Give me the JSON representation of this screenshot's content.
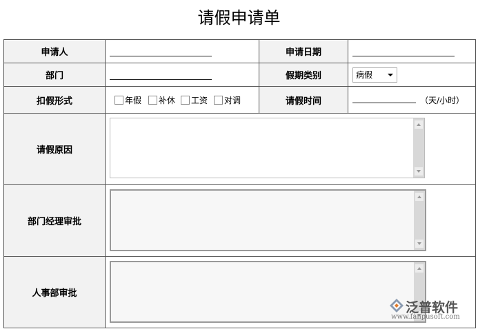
{
  "title": "请假申请单",
  "labels": {
    "applicant": "申请人",
    "apply_date": "申请日期",
    "department": "部门",
    "leave_type": "假期类别",
    "deduct_type": "扣假形式",
    "leave_time": "请假时间",
    "reason": "请假原因",
    "manager_approval": "部门经理审批",
    "hr_approval": "人事部审批"
  },
  "leave_type_select": {
    "selected": "病假"
  },
  "deduct_options": [
    "年假",
    "补休",
    "工资",
    "对调"
  ],
  "time_unit": "（天/小时）",
  "logo": {
    "name": "泛普软件",
    "url": "www.fanpusoft.com"
  }
}
